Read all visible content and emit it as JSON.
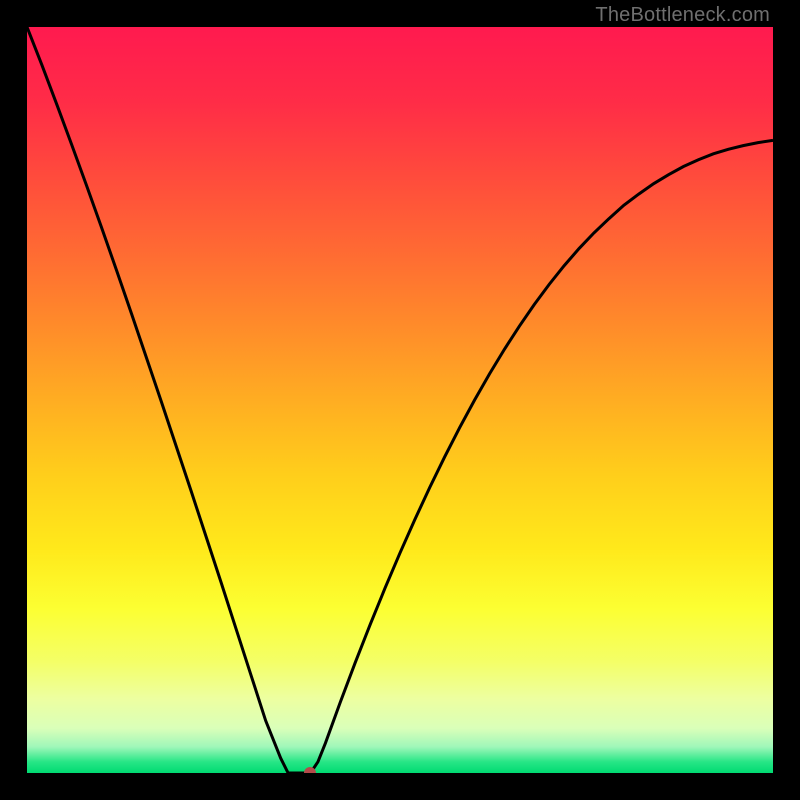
{
  "watermark": "TheBottleneck.com",
  "gradient": {
    "stops": [
      {
        "offset": 0.0,
        "color": "#ff1a4f"
      },
      {
        "offset": 0.1,
        "color": "#ff2c47"
      },
      {
        "offset": 0.2,
        "color": "#ff4b3c"
      },
      {
        "offset": 0.3,
        "color": "#ff6a33"
      },
      {
        "offset": 0.4,
        "color": "#ff8b2a"
      },
      {
        "offset": 0.5,
        "color": "#ffad22"
      },
      {
        "offset": 0.6,
        "color": "#ffce1b"
      },
      {
        "offset": 0.7,
        "color": "#ffe91b"
      },
      {
        "offset": 0.78,
        "color": "#fcff32"
      },
      {
        "offset": 0.85,
        "color": "#f4ff66"
      },
      {
        "offset": 0.9,
        "color": "#edffa0"
      },
      {
        "offset": 0.94,
        "color": "#daffb9"
      },
      {
        "offset": 0.965,
        "color": "#9ff7b9"
      },
      {
        "offset": 0.985,
        "color": "#27e686"
      },
      {
        "offset": 1.0,
        "color": "#00db72"
      }
    ]
  },
  "chart_data": {
    "type": "line",
    "title": "",
    "xlabel": "",
    "ylabel": "",
    "xlim": [
      0,
      100
    ],
    "ylim": [
      0,
      100
    ],
    "x": [
      0,
      2,
      4,
      6,
      8,
      10,
      12,
      14,
      16,
      18,
      20,
      22,
      24,
      26,
      28,
      30,
      32,
      34,
      35,
      36,
      37,
      38,
      39,
      40,
      42,
      44,
      46,
      48,
      50,
      52,
      54,
      56,
      58,
      60,
      62,
      64,
      66,
      68,
      70,
      72,
      74,
      76,
      78,
      80,
      82,
      84,
      86,
      88,
      90,
      92,
      94,
      96,
      98,
      100
    ],
    "y": [
      100,
      94.9,
      89.6,
      84.2,
      78.7,
      73.1,
      67.4,
      61.6,
      55.7,
      49.8,
      43.8,
      37.8,
      31.7,
      25.6,
      19.4,
      13.2,
      7.0,
      2.0,
      0.0,
      0.0,
      0.0,
      0.0,
      1.5,
      4.0,
      9.5,
      14.8,
      19.9,
      24.8,
      29.5,
      34.0,
      38.3,
      42.4,
      46.3,
      50.0,
      53.5,
      56.8,
      59.9,
      62.8,
      65.5,
      68.0,
      70.3,
      72.4,
      74.3,
      76.1,
      77.6,
      79.0,
      80.2,
      81.3,
      82.2,
      83.0,
      83.6,
      84.1,
      84.5,
      84.8
    ],
    "marker": {
      "x": 38,
      "y": 0
    }
  },
  "curve_color": "#000000",
  "curve_width": 3,
  "dot_color": "#b44a4a"
}
